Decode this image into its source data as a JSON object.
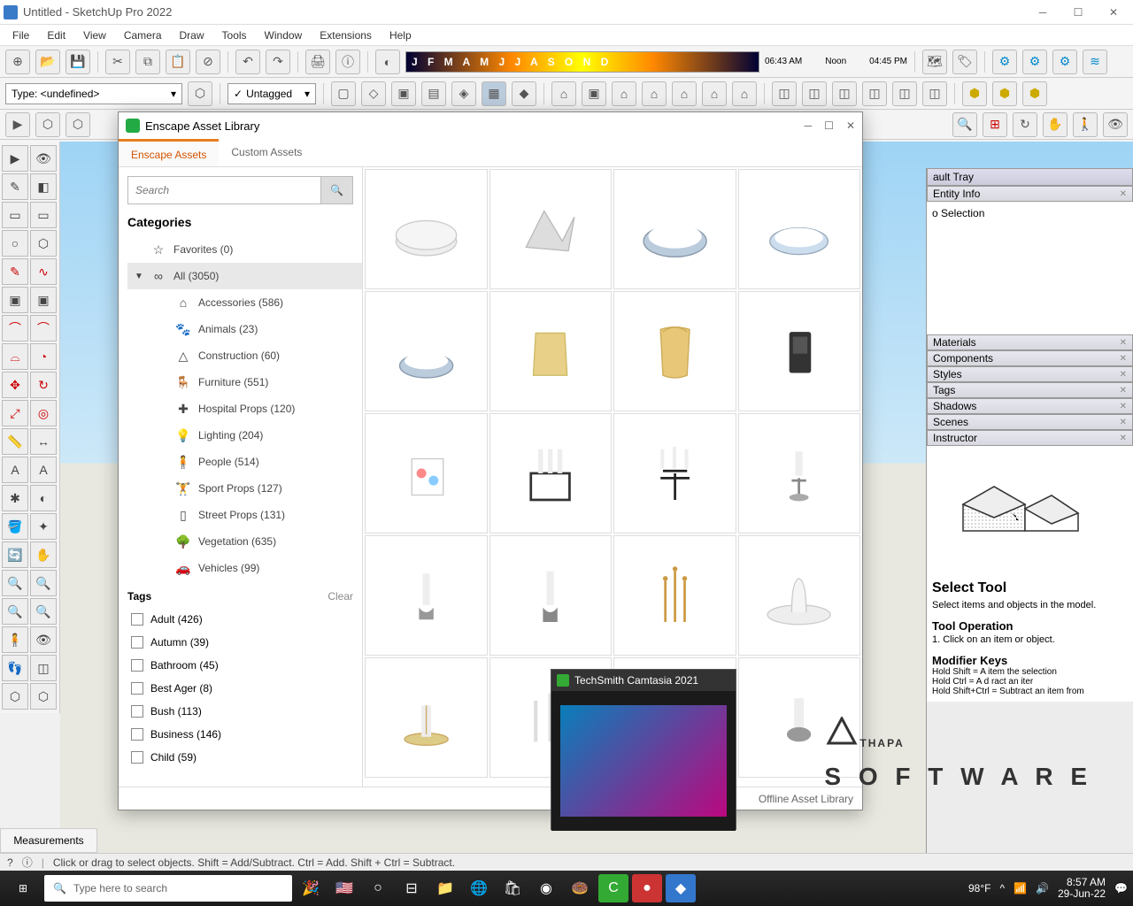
{
  "window": {
    "title": "Untitled - SketchUp Pro 2022"
  },
  "menu": [
    "File",
    "Edit",
    "View",
    "Camera",
    "Draw",
    "Tools",
    "Window",
    "Extensions",
    "Help"
  ],
  "type_field": "Type: <undefined>",
  "tag_field": "Untagged",
  "time_slider": {
    "left": "06:43 AM",
    "mid": "Noon",
    "right": "04:45 PM",
    "months": "J F M A M J J A S O N D"
  },
  "tray": {
    "header": "ault Tray",
    "entity_info": "Entity Info",
    "no_selection": "o Selection",
    "panels": [
      "Materials",
      "Components",
      "Styles",
      "Tags",
      "Shadows",
      "Scenes",
      "Instructor"
    ],
    "instructor": {
      "title": "Select Tool",
      "desc": "Select items and objects in the model.",
      "op_title": "Tool Operation",
      "op_step": "1. Click on an item or object.",
      "mod_title": "Modifier Keys",
      "mod1": "Hold Shift = A   item   the selection",
      "mod2": "Hold Ctrl = A   d   ract an iter",
      "mod3": "Hold Shift+Ctrl = Subtract an item from"
    }
  },
  "enscape": {
    "title": "Enscape Asset Library",
    "tabs": {
      "active": "Enscape Assets",
      "other": "Custom Assets"
    },
    "search_placeholder": "Search",
    "categories_label": "Categories",
    "favorites": "Favorites (0)",
    "all": "All (3050)",
    "cats": [
      {
        "icon": "⌂",
        "label": "Accessories (586)"
      },
      {
        "icon": "🐾",
        "label": "Animals (23)"
      },
      {
        "icon": "△",
        "label": "Construction (60)"
      },
      {
        "icon": "🪑",
        "label": "Furniture (551)"
      },
      {
        "icon": "✚",
        "label": "Hospital Props (120)"
      },
      {
        "icon": "💡",
        "label": "Lighting (204)"
      },
      {
        "icon": "🧍",
        "label": "People (514)"
      },
      {
        "icon": "🏋",
        "label": "Sport Props (127)"
      },
      {
        "icon": "▯",
        "label": "Street Props (131)"
      },
      {
        "icon": "🌳",
        "label": "Vegetation (635)"
      },
      {
        "icon": "🚗",
        "label": "Vehicles (99)"
      }
    ],
    "tags_label": "Tags",
    "clear": "Clear",
    "tags": [
      "Adult (426)",
      "Autumn (39)",
      "Bathroom (45)",
      "Best Ager (8)",
      "Bush (113)",
      "Business (146)",
      "Child (59)"
    ],
    "footer": "Offline Asset Library"
  },
  "status": {
    "measurements": "Measurements",
    "hint": "Click or drag to select objects. Shift = Add/Subtract. Ctrl = Add. Shift + Ctrl = Subtract."
  },
  "taskbar": {
    "search": "Type here to search",
    "temp": "98°F",
    "time": "8:57 AM",
    "date": "29-Jun-22"
  },
  "camtasia": {
    "title": "TechSmith Camtasia 2021"
  },
  "watermark": {
    "l1": "THAPA",
    "l2": "S O F T W A R E"
  }
}
